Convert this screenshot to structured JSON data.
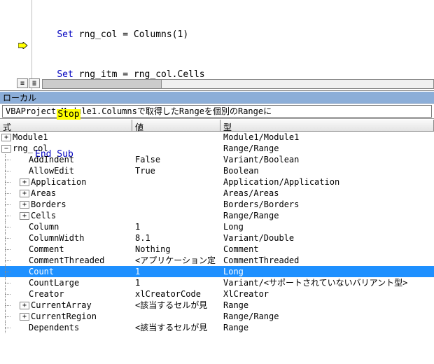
{
  "code": {
    "line1_pre": "    ",
    "line1_kw": "Set",
    "line1_rest": " rng_col = Columns(1)",
    "line2_pre": "    ",
    "line2_kw": "Set",
    "line2_rest": " rng_itm = rng_col.Cells",
    "line3_pre": "    ",
    "line3_stop": "Stop",
    "line4": "End Sub"
  },
  "locals": {
    "title": "ローカル",
    "context": "VBAProject.Module1.Columnsで取得したRangeを個別のRangeに"
  },
  "headers": {
    "expr": "式",
    "val": "値",
    "type": "型"
  },
  "rows": [
    {
      "indent": 0,
      "twist": "plus",
      "expr": "Module1",
      "val": "",
      "type": "Module1/Module1",
      "sel": false
    },
    {
      "indent": 0,
      "twist": "minus",
      "expr": "rng_col",
      "val": "",
      "type": "Range/Range",
      "sel": false
    },
    {
      "indent": 1,
      "twist": "none",
      "expr": "AddIndent",
      "val": "False",
      "type": "Variant/Boolean",
      "sel": false
    },
    {
      "indent": 1,
      "twist": "none",
      "expr": "AllowEdit",
      "val": "True",
      "type": "Boolean",
      "sel": false
    },
    {
      "indent": 1,
      "twist": "plus",
      "expr": "Application",
      "val": "",
      "type": "Application/Application",
      "sel": false
    },
    {
      "indent": 1,
      "twist": "plus",
      "expr": "Areas",
      "val": "",
      "type": "Areas/Areas",
      "sel": false
    },
    {
      "indent": 1,
      "twist": "plus",
      "expr": "Borders",
      "val": "",
      "type": "Borders/Borders",
      "sel": false
    },
    {
      "indent": 1,
      "twist": "plus",
      "expr": "Cells",
      "val": "",
      "type": "Range/Range",
      "sel": false
    },
    {
      "indent": 1,
      "twist": "none",
      "expr": "Column",
      "val": "1",
      "type": "Long",
      "sel": false
    },
    {
      "indent": 1,
      "twist": "none",
      "expr": "ColumnWidth",
      "val": "8.1",
      "type": "Variant/Double",
      "sel": false
    },
    {
      "indent": 1,
      "twist": "none",
      "expr": "Comment",
      "val": "Nothing",
      "type": "Comment",
      "sel": false
    },
    {
      "indent": 1,
      "twist": "none",
      "expr": "CommentThreaded",
      "val": "<アプリケーション定",
      "type": "CommentThreaded",
      "sel": false
    },
    {
      "indent": 1,
      "twist": "none",
      "expr": "Count",
      "val": "1",
      "type": "Long",
      "sel": true
    },
    {
      "indent": 1,
      "twist": "none",
      "expr": "CountLarge",
      "val": "1",
      "type": "Variant/<サポートされていないバリアント型>",
      "sel": false
    },
    {
      "indent": 1,
      "twist": "none",
      "expr": "Creator",
      "val": "xlCreatorCode",
      "type": "XlCreator",
      "sel": false
    },
    {
      "indent": 1,
      "twist": "plus",
      "expr": "CurrentArray",
      "val": "<該当するセルが見",
      "type": "Range",
      "sel": false
    },
    {
      "indent": 1,
      "twist": "plus",
      "expr": "CurrentRegion",
      "val": "",
      "type": "Range/Range",
      "sel": false
    },
    {
      "indent": 1,
      "twist": "none",
      "expr": "Dependents",
      "val": "<該当するセルが見",
      "type": "Range",
      "sel": false
    }
  ]
}
